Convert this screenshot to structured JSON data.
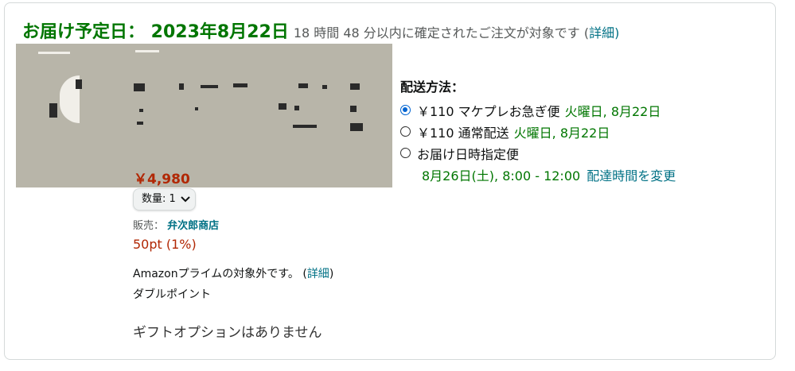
{
  "header": {
    "delivery_label": "お届け予定日： 2023年8月22日",
    "note_prefix": "18 時間 48 分以内に確定されたご注文が対象です (",
    "detail_link": "詳細",
    "note_suffix": ")"
  },
  "item": {
    "price": "￥4,980",
    "quantity_label": "数量: 1",
    "seller_label": "販売：",
    "seller_name": "弁次郎商店",
    "points": "50pt (1%)",
    "prime_note": "Amazonプライムの対象外です。 (",
    "prime_detail": "詳細",
    "prime_suffix": ")",
    "double_point": "ダブルポイント",
    "gift_note": "ギフトオプションはありません"
  },
  "shipping": {
    "title": "配送方法：",
    "options": [
      {
        "text": "￥110 マケプレお急ぎ便",
        "date": "火曜日, 8月22日",
        "selected": true
      },
      {
        "text": "￥110 通常配送",
        "date": "火曜日, 8月22日",
        "selected": false
      },
      {
        "text": "お届け日時指定便",
        "date": "",
        "selected": false
      }
    ],
    "scheduled_time": "8月26日(土), 8:00 - 12:00",
    "change_time": "配達時間を変更"
  },
  "colors": {
    "green": "#007600",
    "link": "#007185",
    "price": "#b12704",
    "radio_selected": "#0064d2"
  }
}
